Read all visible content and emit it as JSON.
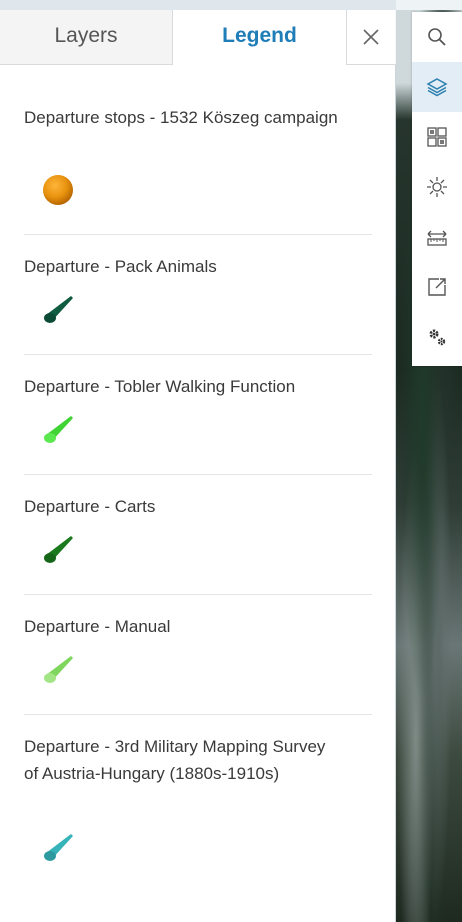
{
  "tabs": {
    "layers_label": "Layers",
    "legend_label": "Legend",
    "close_icon": "close-icon"
  },
  "legend": {
    "items": [
      {
        "label": "Departure stops - 1532 Köszeg campaign",
        "symbol": "circle",
        "color": "#e8930e"
      },
      {
        "label": "Departure - Pack Animals",
        "symbol": "cone",
        "color": "#0f5c41"
      },
      {
        "label": "Departure - Tobler Walking Function",
        "symbol": "cone",
        "color": "#3fd334"
      },
      {
        "label": "Departure - Carts",
        "symbol": "cone",
        "color": "#1c7a1e"
      },
      {
        "label": "Departure - Manual",
        "symbol": "cone",
        "color": "#7fd65c"
      },
      {
        "label": "Departure - 3rd Military Mapping Survey of Austria-Hungary (1880s-1910s)",
        "symbol": "cone",
        "color": "#36b3b8"
      }
    ]
  },
  "toolbar": {
    "tools": [
      {
        "name": "search-icon",
        "active": false
      },
      {
        "name": "layers-icon",
        "active": true
      },
      {
        "name": "basemap-gallery-icon",
        "active": false
      },
      {
        "name": "daylight-icon",
        "active": false
      },
      {
        "name": "measure-icon",
        "active": false
      },
      {
        "name": "share-icon",
        "active": false
      },
      {
        "name": "settings-icon",
        "active": false
      }
    ]
  }
}
